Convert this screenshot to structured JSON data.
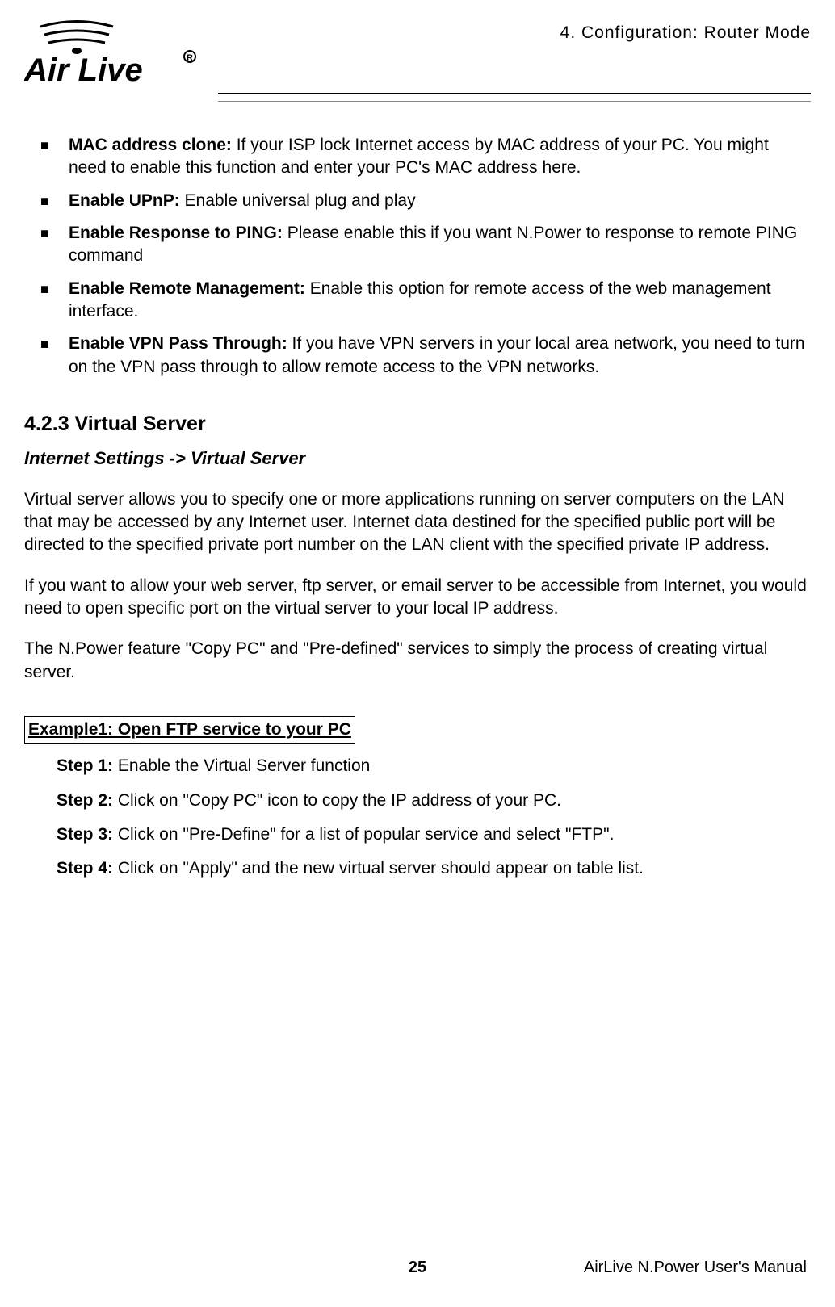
{
  "header": {
    "chapter": "4.  Configuration:  Router  Mode",
    "logo_alt": "Air Live"
  },
  "bullets": [
    {
      "label": "MAC address clone:",
      "text": "   If your ISP lock Internet access by MAC address of your PC. You might need to enable this function and enter your PC's MAC address here."
    },
    {
      "label": "Enable UPnP:",
      "text": "   Enable universal plug and play"
    },
    {
      "label": "Enable Response to PING:",
      "text": "   Please enable this if you want N.Power to response to remote PING command"
    },
    {
      "label": "Enable Remote Management:",
      "text": "   Enable this option for remote access of the web management interface."
    },
    {
      "label": "Enable VPN Pass Through:",
      "text": "   If you have VPN servers in your local area network, you need to turn on the VPN pass through to allow remote access to the VPN networks."
    }
  ],
  "section": {
    "number_title": "4.2.3 Virtual Server",
    "breadcrumb": "Internet Settings -> Virtual Server",
    "para1": "Virtual server allows you to specify one or more applications running on server computers on the LAN that may be accessed by any Internet user. Internet data destined for the specified public port will be directed to the specified private port number on the LAN client with the specified private IP address.",
    "para2": "If you want to allow your web server, ftp server, or email server to be accessible from Internet, you would need to open specific port on the virtual server to your local IP address.",
    "para3": "The N.Power feature \"Copy PC\" and \"Pre-defined\" services to simply the process of creating virtual server."
  },
  "example": {
    "title": "Example1: Open FTP service to your PC",
    "steps": [
      {
        "label": "Step 1:",
        "text": " Enable the Virtual Server function"
      },
      {
        "label": "Step 2:",
        "text": " Click on \"Copy PC\" icon to copy the IP address of your PC."
      },
      {
        "label": "Step 3:",
        "text": " Click on \"Pre-Define\" for a list of popular service and select \"FTP\"."
      },
      {
        "label": "Step 4:",
        "text": " Click on \"Apply\" and the new virtual server should appear on table list."
      }
    ]
  },
  "footer": {
    "page": "25",
    "manual": "AirLive N.Power User's Manual"
  }
}
